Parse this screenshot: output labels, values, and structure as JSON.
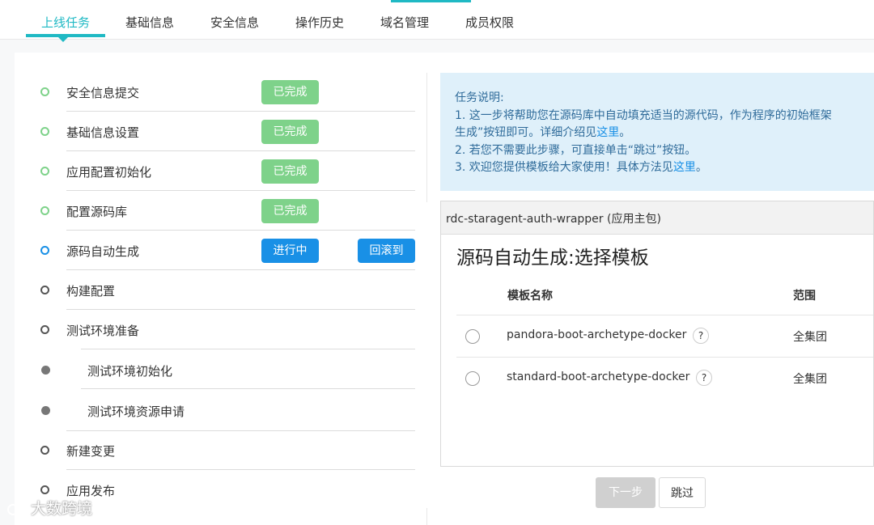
{
  "tabs": [
    {
      "label": "上线任务",
      "active": true
    },
    {
      "label": "基础信息"
    },
    {
      "label": "安全信息"
    },
    {
      "label": "操作历史"
    },
    {
      "label": "域名管理"
    },
    {
      "label": "成员权限"
    }
  ],
  "steps": [
    {
      "label": "安全信息提交",
      "status": "done",
      "badge": "已完成"
    },
    {
      "label": "基础信息设置",
      "status": "done",
      "badge": "已完成"
    },
    {
      "label": "应用配置初始化",
      "status": "done",
      "badge": "已完成"
    },
    {
      "label": "配置源码库",
      "status": "done",
      "badge": "已完成"
    },
    {
      "label": "源码自动生成",
      "status": "active",
      "badge": "进行中",
      "action": "回滚到"
    },
    {
      "label": "构建配置",
      "status": "todo"
    },
    {
      "label": "测试环境准备",
      "status": "todo"
    },
    {
      "label": "测试环境初始化",
      "status": "sub"
    },
    {
      "label": "测试环境资源申请",
      "status": "sub"
    },
    {
      "label": "新建变更",
      "status": "todo"
    },
    {
      "label": "应用发布",
      "status": "todo"
    }
  ],
  "info": {
    "title": "任务说明:",
    "line1": "1. 这一步将帮助您在源码库中自动填充适当的源代码，作为程序的初始框架",
    "line2_prefix": "生成”按钮即可。详细介绍见",
    "line2_link": "这里",
    "line2_suffix": "。",
    "line3": "2. 若您不需要此步骤，可直接单击“跳过”按钮。",
    "line4_prefix": "3. 欢迎您提供模板给大家使用！具体方法见",
    "line4_link": "这里",
    "line4_suffix": "。"
  },
  "panel": {
    "header": "rdc-staragent-auth-wrapper (应用主包)",
    "title": "源码自动生成:选择模板",
    "col_name": "模板名称",
    "col_scope": "范围",
    "rows": [
      {
        "name": "pandora-boot-archetype-docker",
        "help": "?",
        "scope": "全集团"
      },
      {
        "name": "standard-boot-archetype-docker",
        "help": "?",
        "scope": "全集团"
      }
    ]
  },
  "buttons": {
    "next": "下一步",
    "skip": "跳过"
  },
  "watermark": "大数跨境",
  "colors": {
    "accent": "#1fb9c4",
    "done": "#7ed28a",
    "active": "#1990e6"
  }
}
